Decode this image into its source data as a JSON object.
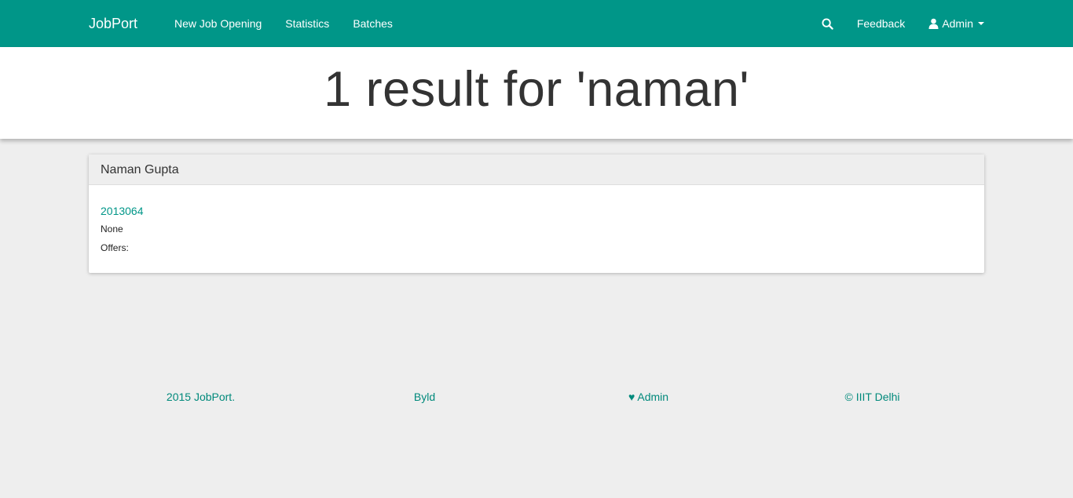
{
  "nav": {
    "brand": "JobPort",
    "links": [
      "New Job Opening",
      "Statistics",
      "Batches"
    ],
    "feedback": "Feedback",
    "user": "Admin",
    "search_icon": "search-icon",
    "user_icon": "user-icon"
  },
  "header": {
    "title": "1 result for 'naman'"
  },
  "result": {
    "name": "Naman Gupta",
    "roll": "2013064",
    "status": "None",
    "offers_label": "Offers:"
  },
  "footer": {
    "copyright_year": "2015 JobPort.",
    "byld": "Byld",
    "admin": "♥ Admin",
    "org": "© IIIT Delhi"
  },
  "colors": {
    "primary": "#009688",
    "background": "#eeeeee"
  }
}
